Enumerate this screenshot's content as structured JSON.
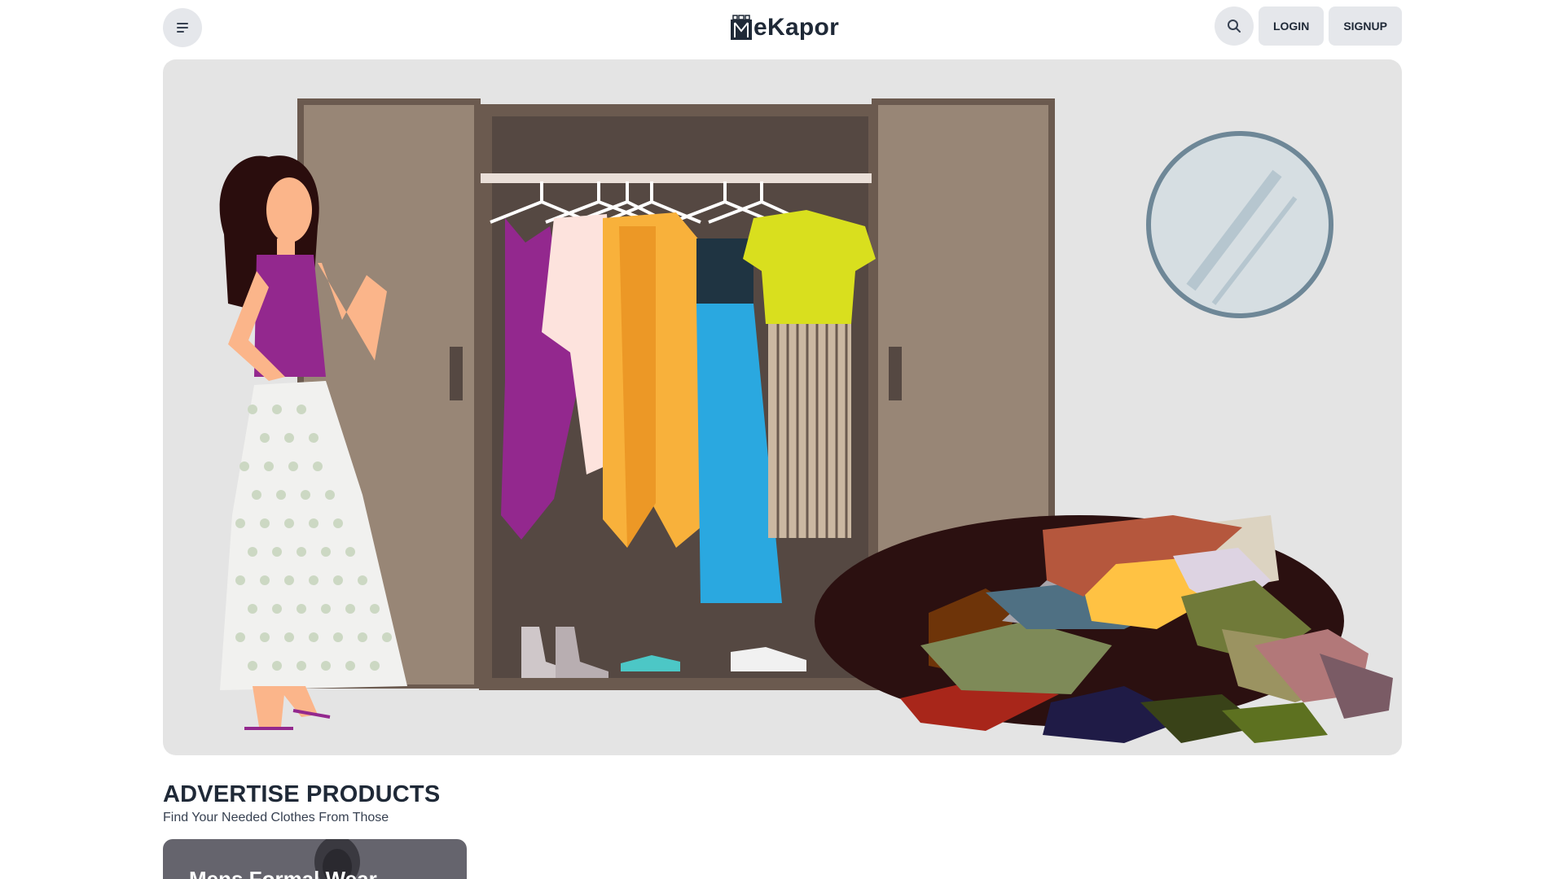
{
  "header": {
    "brand_prefix": "M",
    "brand_name": "eKapor",
    "login_label": "LOGIN",
    "signup_label": "SIGNUP"
  },
  "section": {
    "title": "ADVERTISE PRODUCTS",
    "subtitle": "Find Your Needed Clothes From Those"
  },
  "cards": [
    {
      "title": "Mens Formal Wear"
    }
  ],
  "icons": {
    "menu": "menu-icon",
    "search": "search-icon",
    "logo": "shop-logo-icon"
  },
  "colors": {
    "background": "#ffffff",
    "button_bg": "#e5e7eb",
    "hero_bg": "#e4e4e4",
    "text": "#1f2937",
    "card_bg": "#65646d"
  }
}
